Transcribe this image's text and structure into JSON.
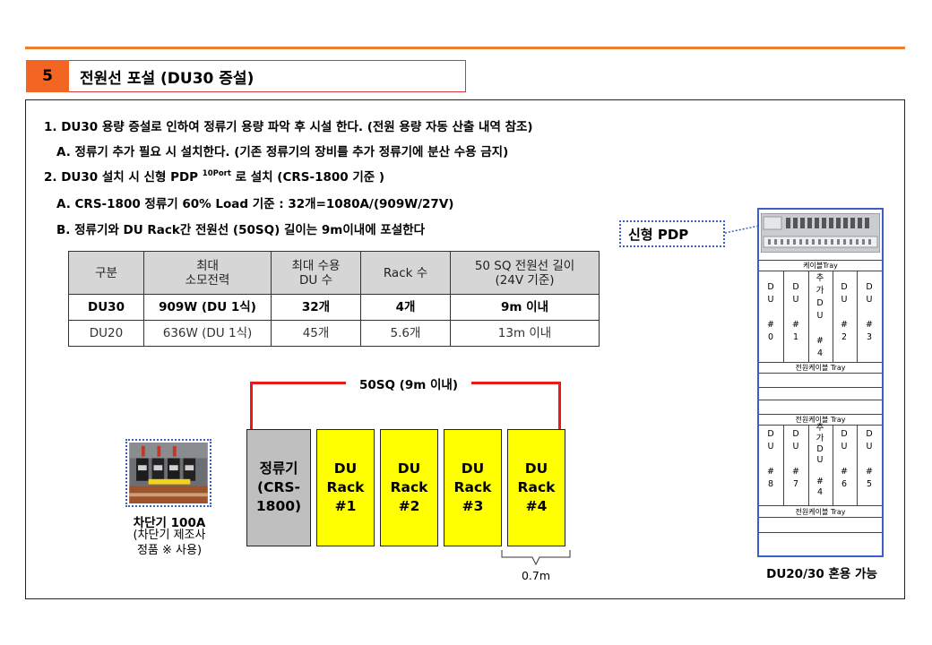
{
  "section": {
    "number": "5",
    "title": "전원선 포설 (DU30 증설)"
  },
  "content": {
    "lines": [
      "1. DU30 용량 증설로 인하여 정류기 용량 파악 후 시설 한다. (전원 용량 자동 산출 내역 참조)",
      "A. 정류기 추가 필요 시 설치한다. (기존 정류기의 장비를 추가 정류기에 분산 수용 금지)",
      "2. DU30 설치 시 신형 PDP",
      "10Port",
      "로 설치 (CRS-1800 기준 )",
      "A. CRS-1800 정류기 60% Load 기준 : 32개=1080A/(909W/27V)",
      "B. 정류기와 DU Rack간 전원선 (50SQ) 길이는 9m이내에 포설한다"
    ]
  },
  "table": {
    "headers": [
      "구분",
      "최대\n소모전력",
      "최대 수용\nDU 수",
      "Rack 수",
      "50 SQ 전원선 길이\n(24V 기준)"
    ],
    "rows": [
      [
        "DU30",
        "909W (DU 1식)",
        "32개",
        "4개",
        "9m 이내"
      ],
      [
        "DU20",
        "636W (DU 1식)",
        "45개",
        "5.6개",
        "13m 이내"
      ]
    ]
  },
  "diagram": {
    "wire_label": "50SQ (9m 이내)",
    "rectifier": "정류기\n(CRS-\n1800)",
    "racks": [
      "DU\nRack\n#1",
      "DU\nRack\n#2",
      "DU\nRack\n#3",
      "DU\nRack\n#4"
    ],
    "rack_gap": "0.7m",
    "breaker_caption": "차단기 100A",
    "breaker_note": "(차단기 제조사\n정품 ※ 사용)",
    "colors": {
      "wire": "#e81b1b",
      "rack_fill": "#ffff00",
      "rectifier_fill": "#bfbfbf",
      "accent": "#f26522"
    }
  },
  "rack_view": {
    "pdp_label": "신형 PDP",
    "top_tray": "케이블Tray",
    "mid_tray": "전원케이블 Tray",
    "mid_tray2": "전원케이블 Tray",
    "bottom_tray": "전원케이블 Tray",
    "upper_slots": [
      "D\nU\n\n#\n0",
      "D\nU\n\n#\n1",
      "추\n가\nD\nU\n\n#\n4",
      "D\nU\n\n#\n2",
      "D\nU\n\n#\n3"
    ],
    "lower_slots": [
      "D\nU\n\n#\n8",
      "D\nU\n\n#\n7",
      "추\n가\nD\nU\n\n#\n4",
      "D\nU\n\n#\n6",
      "D\nU\n\n#\n5"
    ],
    "caption": "DU20/30 혼용 가능"
  }
}
